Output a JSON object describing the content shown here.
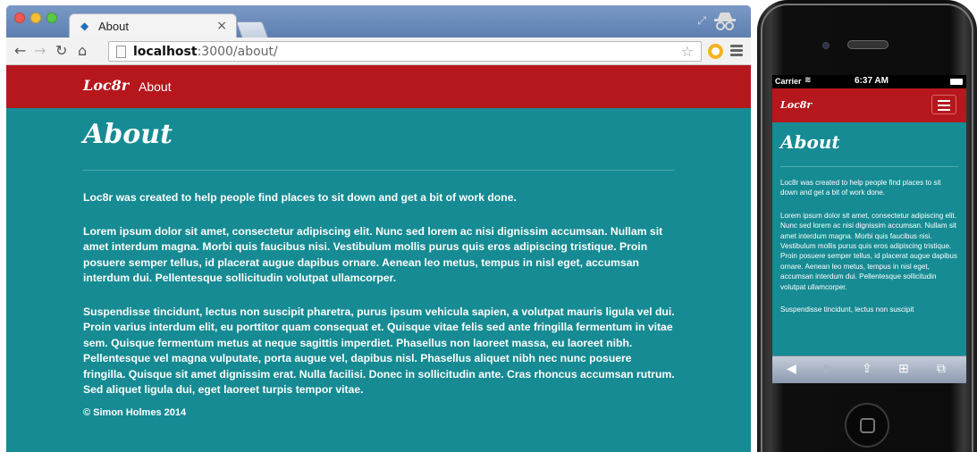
{
  "browser": {
    "tab_title": "About",
    "tab_close": "×",
    "url_host": "localhost",
    "url_rest": ":3000/about/"
  },
  "site": {
    "brand": "Loc8r",
    "nav": {
      "about": "About"
    },
    "page_title": "About",
    "paragraphs": [
      "Loc8r was created to help people find places to sit down and get a bit of work done.",
      "Lorem ipsum dolor sit amet, consectetur adipiscing elit. Nunc sed lorem ac nisi dignissim accumsan. Nullam sit amet interdum magna. Morbi quis faucibus nisi. Vestibulum mollis purus quis eros adipiscing tristique. Proin posuere semper tellus, id placerat augue dapibus ornare. Aenean leo metus, tempus in nisl eget, accumsan interdum dui. Pellentesque sollicitudin volutpat ullamcorper.",
      "Suspendisse tincidunt, lectus non suscipit pharetra, purus ipsum vehicula sapien, a volutpat mauris ligula vel dui. Proin varius interdum elit, eu porttitor quam consequat et. Quisque vitae felis sed ante fringilla fermentum in vitae sem. Quisque fermentum metus at neque sagittis imperdiet. Phasellus non laoreet massa, eu laoreet nibh. Pellentesque vel magna vulputate, porta augue vel, dapibus nisl. Phasellus aliquet nibh nec nunc posuere fringilla. Quisque sit amet dignissim erat. Nulla facilisi. Donec in sollicitudin ante. Cras rhoncus accumsan rutrum. Sed aliquet ligula dui, eget laoreet turpis tempor vitae."
    ],
    "footer": "© Simon Holmes 2014"
  },
  "phone": {
    "carrier": "Carrier",
    "time": "6:37 AM",
    "mobile_paragraphs": [
      "Loc8r was created to help people find places to sit down and get a bit of work done.",
      "Lorem ipsum dolor sit amet, consectetur adipiscing elit. Nunc sed lorem ac nisi dignissim accumsan. Nullam sit amet interdum magna. Morbi quis faucibus nisi. Vestibulum mollis purus quis eros adipiscing tristique. Proin posuere semper tellus, id placerat augue dapibus ornare. Aenean leo metus, tempus in nisl eget, accumsan interdum dui. Pellentesque sollicitudin volutpat ullamcorper.",
      "Suspendisse tincidunt, lectus non suscipit"
    ]
  },
  "colors": {
    "teal": "#168b93",
    "navbar_red": "#b5171d"
  },
  "icons": [
    "back-icon",
    "forward-icon",
    "reload-icon",
    "home-icon",
    "page-icon",
    "star-icon",
    "extension-icon",
    "menu-icon",
    "incognito-icon",
    "hamburger-icon",
    "share-icon",
    "bookmarks-icon",
    "tabs-icon"
  ]
}
